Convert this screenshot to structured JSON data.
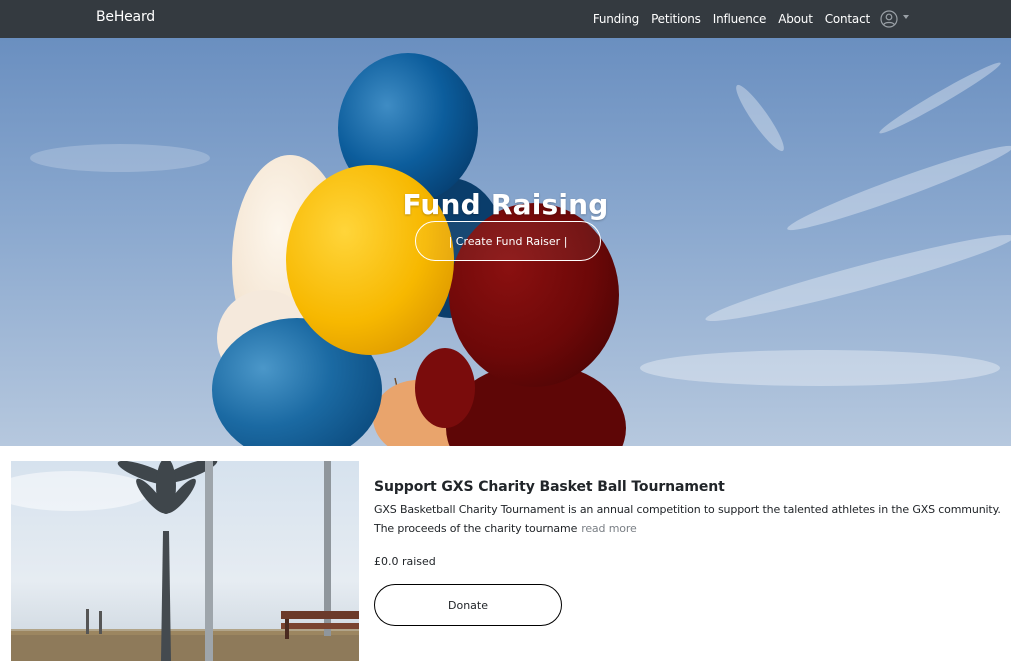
{
  "navbar": {
    "brand": "BeHeard",
    "links": [
      "Funding",
      "Petitions",
      "Influence",
      "About",
      "Contact"
    ],
    "user_icon": "user-circle-icon",
    "dropdown_icon": "caret-down-icon",
    "background": "#343a40"
  },
  "hero": {
    "title": "Fund Raising",
    "button_label": "| Create Fund Raiser |",
    "image": "balloons-sky-photo"
  },
  "fundraisers": [
    {
      "title": "Support GXS Charity Basket Ball Tournament",
      "description": "GXS Basketball Charity Tournament is an annual competition to support the talented athletes in the GXS community. The proceeds of the charity tourname",
      "read_more": "read more",
      "raised": "£0.0 raised",
      "donate_label": "Donate",
      "image": "palm-tree-bench-photo"
    }
  ]
}
